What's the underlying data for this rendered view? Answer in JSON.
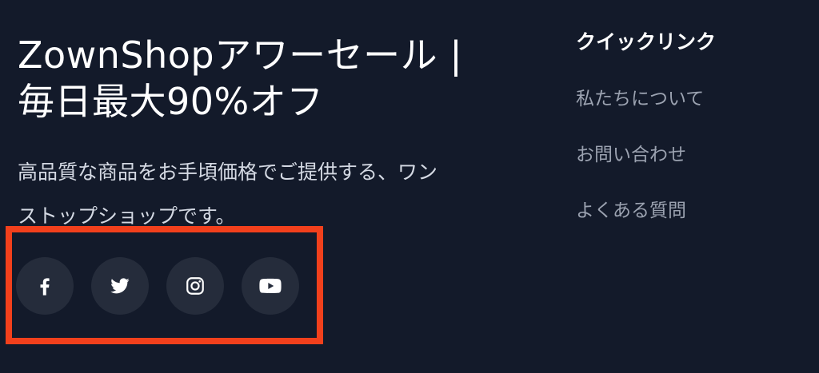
{
  "brand": {
    "title_line1": "ZownShopアワーセール |",
    "title_line2": "毎日最大90%オフ",
    "desc_line1": "高品質な商品をお手頃価格でご提供する、ワン",
    "desc_line2": "ストップショップです。"
  },
  "social": {
    "icons": [
      "facebook-icon",
      "twitter-icon",
      "instagram-icon",
      "youtube-icon"
    ],
    "icon_color": "#ffffff",
    "button_color": "#252c3b"
  },
  "quick_links": {
    "title": "クイックリンク",
    "items": [
      {
        "label": "私たちについて"
      },
      {
        "label": "お問い合わせ"
      },
      {
        "label": "よくある質問"
      }
    ]
  },
  "colors": {
    "background": "#131a2a",
    "highlight": "#f2401c",
    "link": "#9ba2b0"
  }
}
